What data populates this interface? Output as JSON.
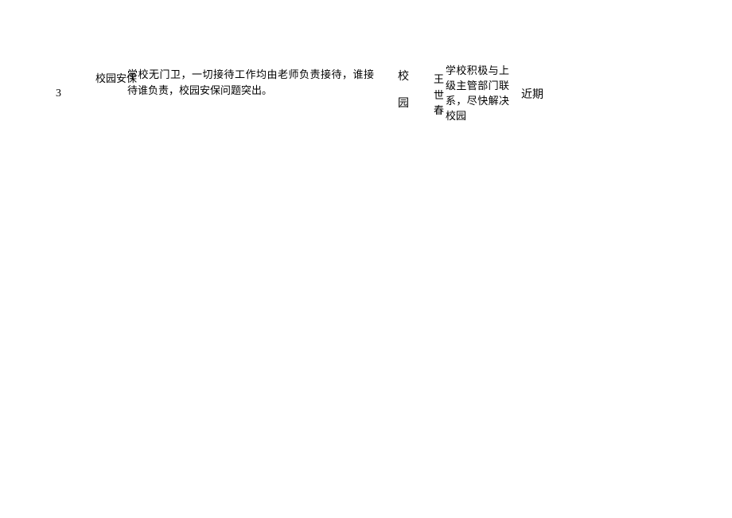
{
  "row": {
    "index": "3",
    "category": "校园安保",
    "description": "学校无门卫，一切接待工作均由老师负责接待，谁接待谁负责，校园安保问题突出。",
    "dept_line1": "校",
    "dept_line2": "园",
    "person_line1": "王",
    "person_line2": "世",
    "person_line3": "春",
    "action": "学校积极与上级主管部门联系，尽快解决校园",
    "time": "近期"
  }
}
